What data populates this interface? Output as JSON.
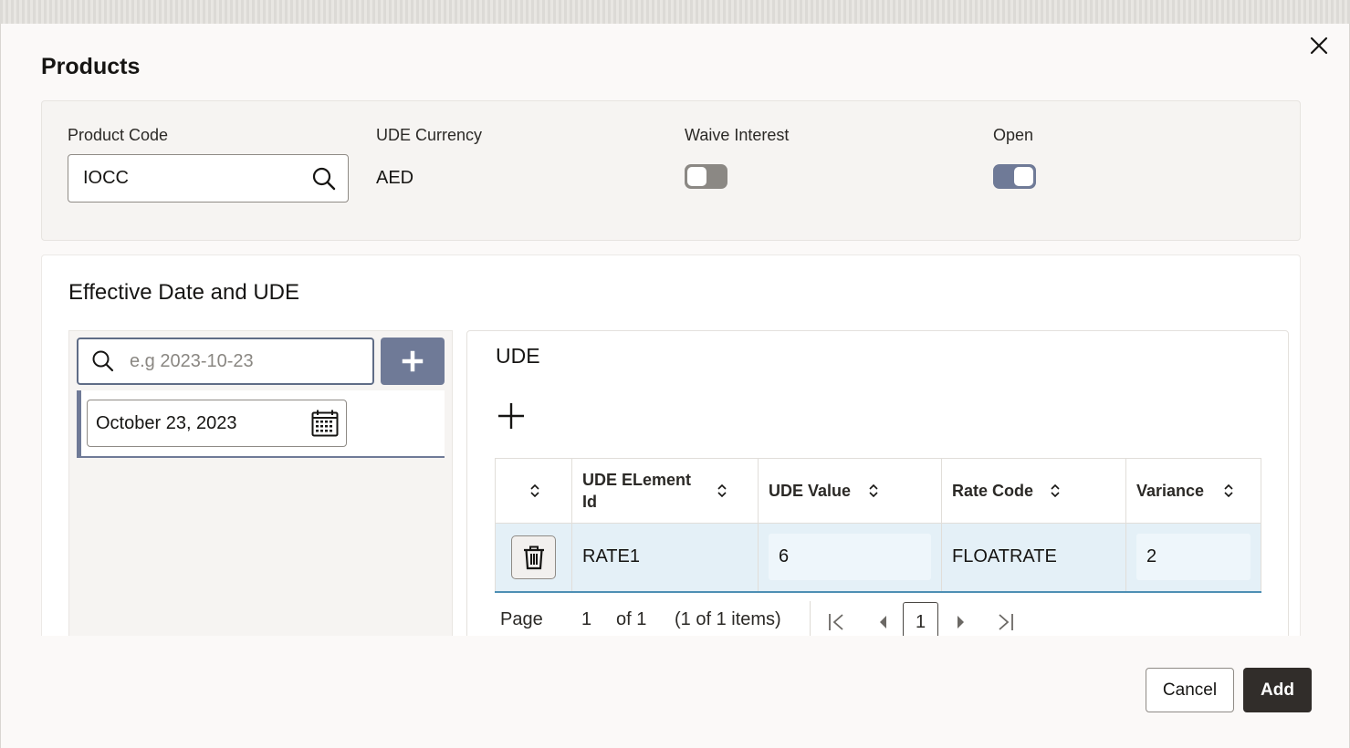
{
  "dialog": {
    "title": "Products",
    "close_icon": "close-icon"
  },
  "product_section": {
    "product_code_label": "Product Code",
    "product_code_value": "IOCC",
    "ude_currency_label": "UDE Currency",
    "ude_currency_value": "AED",
    "waive_interest_label": "Waive Interest",
    "waive_interest_on": false,
    "open_label": "Open",
    "open_on": true
  },
  "effective_section": {
    "title": "Effective Date and UDE",
    "date_search_placeholder": "e.g 2023-10-23",
    "dates": [
      "October 23, 2023"
    ]
  },
  "ude_table": {
    "title": "UDE",
    "columns": [
      "UDE ELement Id",
      "UDE Value",
      "Rate Code",
      "Variance"
    ],
    "rows": [
      {
        "element_id": "RATE1",
        "ude_value": "6",
        "rate_code": "FLOATRATE",
        "variance": "2"
      }
    ]
  },
  "pagination": {
    "page_label": "Page",
    "page_value": "1",
    "of_label": "of 1",
    "items_label": "(1 of 1 items)",
    "current_page": "1"
  },
  "footer": {
    "cancel_label": "Cancel",
    "add_label": "Add"
  },
  "colors": {
    "accent": "#6f7a97",
    "primary_button": "#312d2a",
    "row_selected": "#e4f0f7",
    "row_border": "#4e8fb4"
  }
}
